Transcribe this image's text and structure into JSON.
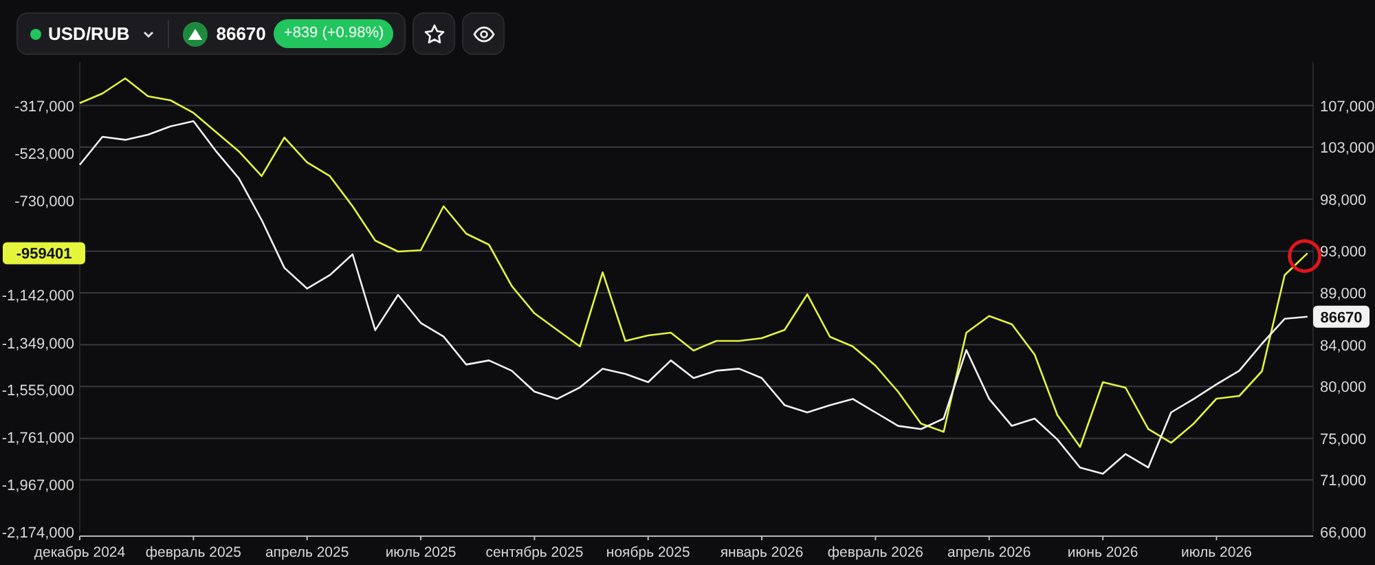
{
  "header": {
    "symbol": "USD/RUB",
    "price": "86670",
    "change": "+839 (+0.98%)"
  },
  "toolbar": [
    {
      "kind": "star"
    },
    {
      "kind": "eye"
    }
  ],
  "chart_data": {
    "type": "line",
    "categories": [
      "декабрь 2024",
      null,
      null,
      null,
      null,
      "февраль 2025",
      null,
      null,
      null,
      null,
      "апрель 2025",
      null,
      null,
      null,
      null,
      "июль 2025",
      null,
      null,
      null,
      null,
      "сентябрь 2025",
      null,
      null,
      null,
      null,
      "ноябрь 2025",
      null,
      null,
      null,
      null,
      "январь 2026",
      null,
      null,
      null,
      null,
      "февраль 2026",
      null,
      null,
      null,
      null,
      "апрель 2026",
      null,
      null,
      null,
      null,
      "июнь 2026",
      null,
      null,
      null,
      null,
      "июль 2026",
      null,
      null,
      null,
      null
    ],
    "grid": true,
    "ylim": [
      -2174000,
      -125000
    ],
    "yticks": [
      {
        "value": -317000,
        "label": "-317,000"
      },
      {
        "value": -523000,
        "label": "-523,000"
      },
      {
        "value": -730000,
        "label": "-730,000"
      },
      {
        "value": -1142000,
        "label": "-1,142,000"
      },
      {
        "value": -1349000,
        "label": "-1,349,000"
      },
      {
        "value": -1555000,
        "label": "-1,555,000"
      },
      {
        "value": -1761000,
        "label": "-1,761,000"
      },
      {
        "value": -1967000,
        "label": "-1,967,000"
      },
      {
        "value": -2174000,
        "label": "-2,174,000"
      }
    ],
    "y2lim": [
      66000,
      111200
    ],
    "y2ticks": [
      {
        "value": 107000,
        "label": "107,000"
      },
      {
        "value": 103000,
        "label": "103,000"
      },
      {
        "value": 98000,
        "label": "98,000"
      },
      {
        "value": 93000,
        "label": "93,000"
      },
      {
        "value": 89000,
        "label": "89,000"
      },
      {
        "value": 84000,
        "label": "84,000"
      },
      {
        "value": 80000,
        "label": "80,000"
      },
      {
        "value": 75000,
        "label": "75,000"
      },
      {
        "value": 71000,
        "label": "71,000"
      },
      {
        "value": 66000,
        "label": "66,000"
      }
    ],
    "series": [
      {
        "color": "#e4f53c",
        "values": [
          -305000,
          -263000,
          -197000,
          -275000,
          -293000,
          -347000,
          -431000,
          -515000,
          -623000,
          -455000,
          -563000,
          -623000,
          -754000,
          -904000,
          -952000,
          -946000,
          -754000,
          -874000,
          -922000,
          -1102000,
          -1221000,
          -1293000,
          -1365000,
          -1042000,
          -1341000,
          -1317000,
          -1305000,
          -1383000,
          -1341000,
          -1341000,
          -1329000,
          -1293000,
          -1138000,
          -1323000,
          -1365000,
          -1449000,
          -1563000,
          -1701000,
          -1737000,
          -1305000,
          -1233000,
          -1269000,
          -1401000,
          -1665000,
          -1803000,
          -1521000,
          -1545000,
          -1725000,
          -1785000,
          -1701000,
          -1593000,
          -1581000,
          -1473000,
          -1054000,
          -959000
        ]
      },
      {
        "axis": "y2",
        "color": "#f2f2f2",
        "values": [
          101300,
          104000,
          103700,
          104200,
          105000,
          105500,
          102600,
          100000,
          96000,
          91400,
          89400,
          90700,
          92700,
          85400,
          88800,
          86100,
          84800,
          82100,
          82500,
          81500,
          79500,
          78800,
          79900,
          81700,
          81200,
          80400,
          82500,
          80800,
          81500,
          81700,
          80800,
          78200,
          77500,
          78200,
          78800,
          77500,
          76200,
          75900,
          76900,
          83500,
          78800,
          76200,
          76900,
          74900,
          72200,
          71600,
          73500,
          72200,
          77500,
          78800,
          80200,
          81500,
          84100,
          86500,
          86700
        ]
      }
    ]
  },
  "price_tags": [
    {
      "text": "-959401"
    },
    {
      "text": "86670"
    }
  ],
  "highlight": {
    "color": "#e0161b"
  }
}
